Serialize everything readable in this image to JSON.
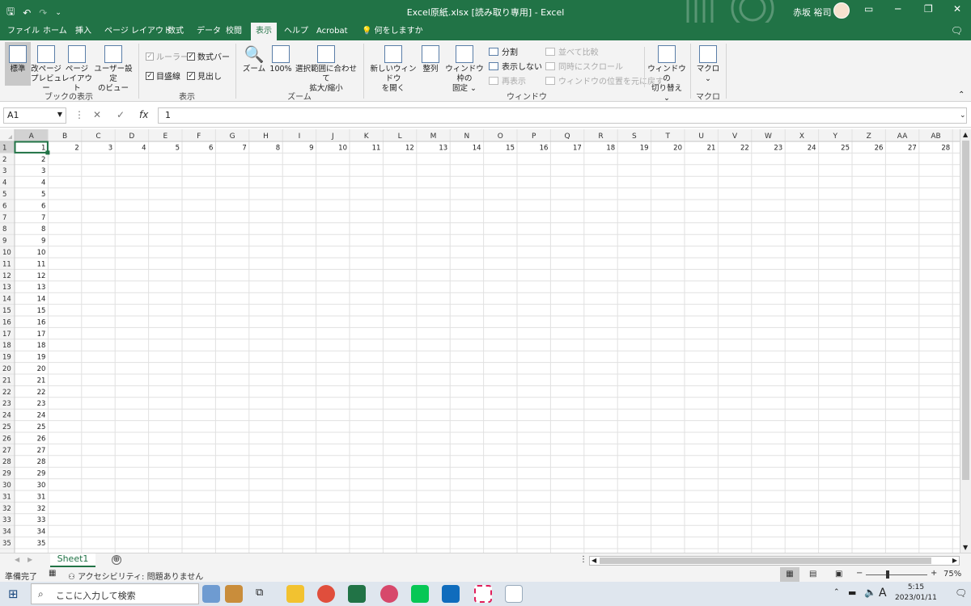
{
  "app": {
    "window_title": "Excel原紙.xlsx [読み取り専用] - Excel",
    "user_name": "赤坂 裕司"
  },
  "colors": {
    "accent": "#217346",
    "active_cell_border": "#217346"
  },
  "qat": {
    "save_icon": "save-icon",
    "undo_icon": "undo-icon",
    "redo_icon": "redo-icon",
    "customize_icon": "customize-icon"
  },
  "tabs": [
    "ファイル",
    "ホーム",
    "挿入",
    "ページ レイアウト",
    "数式",
    "データ",
    "校閲",
    "表示",
    "ヘルプ",
    "Acrobat"
  ],
  "active_tab": "表示",
  "tell_me": "何をしますか",
  "ribbon": {
    "book_views": {
      "label": "ブックの表示",
      "normal": "標準",
      "page_break_1": "改ページ",
      "page_break_2": "プレビュー",
      "page_layout_1": "ページ",
      "page_layout_2": "レイアウト",
      "custom_views_1": "ユーザー設定",
      "custom_views_2": "のビュー"
    },
    "show": {
      "label": "表示",
      "ruler": "ルーラー",
      "formula_bar": "数式バー",
      "gridlines": "目盛線",
      "headings": "見出し"
    },
    "zoom": {
      "label": "ズーム",
      "zoom": "ズーム",
      "zoom100": "100%",
      "zoom_to_sel_1": "選択範囲に合わせて",
      "zoom_to_sel_2": "拡大/縮小"
    },
    "window": {
      "label": "ウィンドウ",
      "new_window_1": "新しいウィンドウ",
      "new_window_2": "を開く",
      "arrange": "整列",
      "freeze_1": "ウィンドウ枠の",
      "freeze_2": "固定 ⌄",
      "split": "分割",
      "hide": "表示しない",
      "unhide": "再表示",
      "side_by_side": "並べて比較",
      "sync_scroll": "同時にスクロール",
      "reset_pos": "ウィンドウの位置を元に戻す",
      "switch_1": "ウィンドウの",
      "switch_2": "切り替え ⌄"
    },
    "macros": {
      "label": "マクロ",
      "macros": "マクロ",
      "dropdown": "⌄"
    }
  },
  "formula_bar": {
    "name_box": "A1",
    "cancel": "✕",
    "enter": "✓",
    "fx": "fx",
    "content": "1"
  },
  "grid": {
    "columns": [
      "A",
      "B",
      "C",
      "D",
      "E",
      "F",
      "G",
      "H",
      "I",
      "J",
      "K",
      "L",
      "M",
      "N",
      "O",
      "P",
      "Q",
      "R",
      "S",
      "T",
      "U",
      "V",
      "W",
      "X",
      "Y",
      "Z",
      "AA",
      "AB"
    ],
    "row_headers": [
      "1",
      "2",
      "3",
      "4",
      "5",
      "6",
      "7",
      "8",
      "9",
      "10",
      "11",
      "12",
      "13",
      "14",
      "15",
      "16",
      "17",
      "18",
      "19",
      "20",
      "21",
      "22",
      "23",
      "24",
      "25",
      "26",
      "27",
      "28",
      "29",
      "30",
      "31",
      "32",
      "33",
      "34",
      "35"
    ],
    "row1_values": [
      "1",
      "2",
      "3",
      "4",
      "5",
      "6",
      "7",
      "8",
      "9",
      "10",
      "11",
      "12",
      "13",
      "14",
      "15",
      "16",
      "17",
      "18",
      "19",
      "20",
      "21",
      "22",
      "23",
      "24",
      "25",
      "26",
      "27",
      "28"
    ],
    "colA_values": [
      "1",
      "2",
      "3",
      "4",
      "5",
      "6",
      "7",
      "8",
      "9",
      "10",
      "11",
      "12",
      "13",
      "14",
      "15",
      "16",
      "17",
      "18",
      "19",
      "20",
      "21",
      "22",
      "23",
      "24",
      "25",
      "26",
      "27",
      "28",
      "29",
      "30",
      "31",
      "32",
      "33",
      "34",
      "35"
    ],
    "active_cell": "A1"
  },
  "sheets": {
    "active": "Sheet1",
    "add_icon": "⊕"
  },
  "status": {
    "ready": "準備完了",
    "accessibility": "アクセシビリティ: 問題ありません",
    "zoom_level": "75%",
    "zoom_minus": "−",
    "zoom_plus": "+"
  },
  "taskbar": {
    "search_placeholder": "ここに入力して検索",
    "time": "5:15",
    "date": "2023/01/11",
    "ime": "A"
  }
}
